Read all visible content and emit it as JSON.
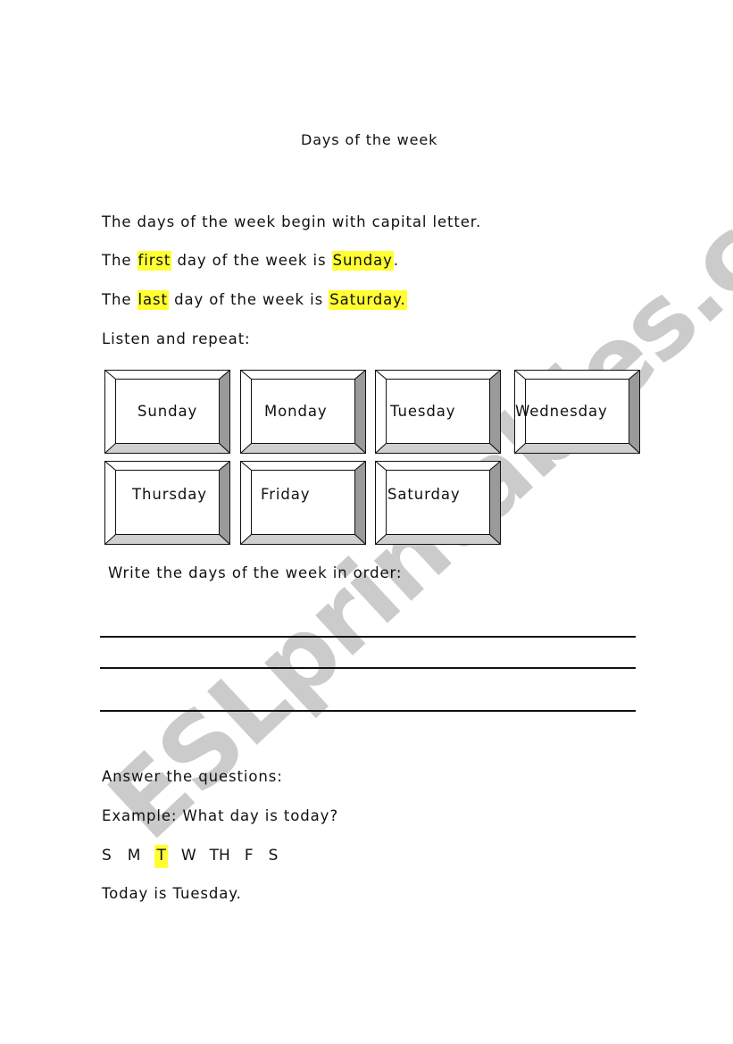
{
  "document": {
    "title": "Days of the week",
    "watermark": "ESLprintables.com",
    "highlight_color": "#ffff33",
    "intro": "The days of the week begin with capital letter.",
    "first_line": {
      "pre": "The ",
      "hl1": "first",
      "mid": " day of the week is ",
      "hl2": "Sunday",
      "post": "."
    },
    "last_line": {
      "pre": "The ",
      "hl1": "last",
      "mid": " day of the week is ",
      "hl2": "Saturday.",
      "post": ""
    },
    "listen_label": "Listen and repeat:",
    "day_cards": [
      {
        "label": "Sunday"
      },
      {
        "label": "Monday"
      },
      {
        "label": "Tuesday"
      },
      {
        "label": "Wednesday"
      },
      {
        "label": "Thursday"
      },
      {
        "label": "Friday"
      },
      {
        "label": "Saturday"
      }
    ],
    "write_label": "Write the days of the week in order:",
    "answer_label": "Answer the questions:",
    "example_question": "Example: What day is today?",
    "day_letters": [
      {
        "text": "S",
        "highlighted": false
      },
      {
        "text": "M",
        "highlighted": false
      },
      {
        "text": "T",
        "highlighted": true
      },
      {
        "text": "W",
        "highlighted": false
      },
      {
        "text": "TH",
        "highlighted": false
      },
      {
        "text": "F",
        "highlighted": false
      },
      {
        "text": "S",
        "highlighted": false
      }
    ],
    "example_answer": "Today is Tuesday."
  }
}
